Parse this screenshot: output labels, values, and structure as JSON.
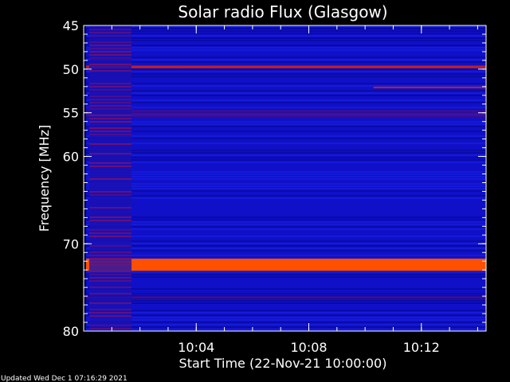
{
  "chart_data": {
    "type": "heatmap",
    "title": "Solar radio Flux (Glasgow)",
    "xlabel": "Start Time (22-Nov-21 10:00:00)",
    "ylabel": "Frequency [MHz]",
    "x_unit": "minutes",
    "xlim": [
      0,
      14.3
    ],
    "ylim": [
      45,
      80
    ],
    "y_reversed": true,
    "x_ticks": [
      {
        "value": 4,
        "label": "10:04"
      },
      {
        "value": 8,
        "label": "10:08"
      },
      {
        "value": 12,
        "label": "10:12"
      }
    ],
    "y_ticks": [
      {
        "value": 45,
        "label": "45"
      },
      {
        "value": 50,
        "label": "50"
      },
      {
        "value": 55,
        "label": "55"
      },
      {
        "value": 60,
        "label": "60"
      },
      {
        "value": 70,
        "label": "70"
      },
      {
        "value": 80,
        "label": "80"
      }
    ],
    "background_color": "#1010c8",
    "features": [
      {
        "kind": "band",
        "freq_from": 72.0,
        "freq_to": 72.8,
        "intensity": "very-high",
        "color": "#ffe060"
      },
      {
        "kind": "band",
        "freq_from": 71.7,
        "freq_to": 73.1,
        "intensity": "high",
        "color": "#ff5000"
      },
      {
        "kind": "band",
        "freq_from": 49.6,
        "freq_to": 49.9,
        "intensity": "medium",
        "color": "#c02020"
      },
      {
        "kind": "band",
        "freq_from": 54.6,
        "freq_to": 55.6,
        "intensity": "low",
        "color": "#5a1080"
      },
      {
        "kind": "band",
        "freq_from": 76.0,
        "freq_to": 76.3,
        "intensity": "low",
        "color": "#5a1080"
      },
      {
        "kind": "segment",
        "time_from": 10.3,
        "time_to": 14.3,
        "freq": 52.1,
        "color": "#c02020"
      },
      {
        "kind": "region",
        "time_from": 0.2,
        "time_to": 1.7,
        "freq_from": 45,
        "freq_to": 80,
        "intensity": "noisy",
        "color": "#8a1060"
      }
    ],
    "colors": {
      "bright": "#ffe060",
      "hot": "#ff5000",
      "red": "#c02020",
      "purple": "#5a1080",
      "dark": "#020040",
      "axis": "#ffffff"
    }
  },
  "footer": {
    "updated": "Updated Wed Dec  1 07:16:29 2021"
  }
}
